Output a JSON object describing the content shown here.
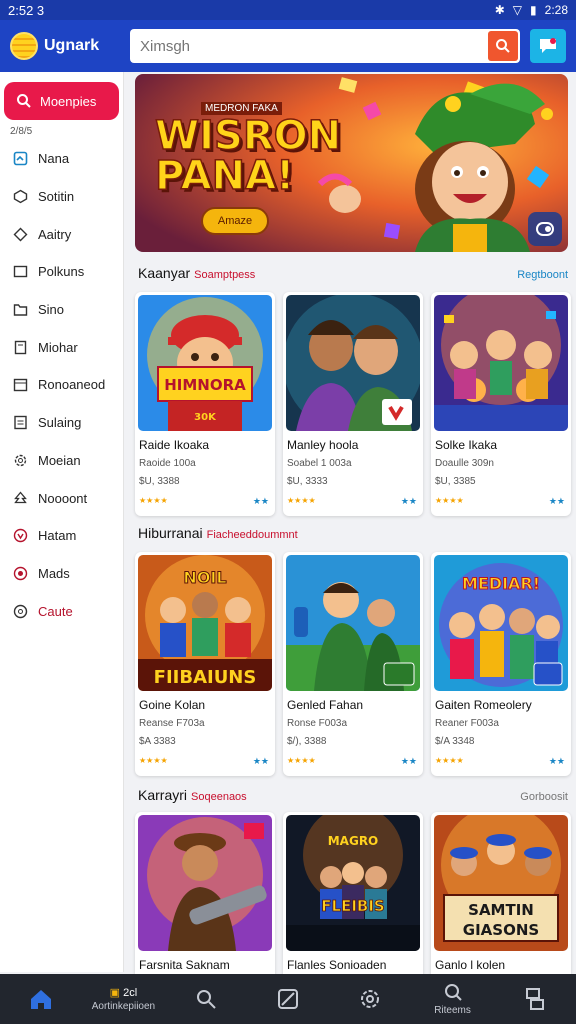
{
  "status": {
    "time": "2:52 3",
    "right_time": "2:28"
  },
  "topbar": {
    "app_name": "Ugnark",
    "search_placeholder": "Ximsgh"
  },
  "sidebar": {
    "active": "Moenpies",
    "small_label": "2/8/5",
    "items": [
      {
        "label": "Nana",
        "icon": "home-icon"
      },
      {
        "label": "Sotitin",
        "icon": "compass-icon"
      },
      {
        "label": "Aaitry",
        "icon": "diamond-icon"
      },
      {
        "label": "Polkuns",
        "icon": "square-icon"
      },
      {
        "label": "Sino",
        "icon": "folder-icon"
      },
      {
        "label": "Miohar",
        "icon": "book-icon"
      },
      {
        "label": "Ronoaneod",
        "icon": "calendar-icon"
      },
      {
        "label": "Sulaing",
        "icon": "document-icon"
      },
      {
        "label": "Moeian",
        "icon": "gear-icon"
      },
      {
        "label": "Noooont",
        "icon": "tree-icon"
      },
      {
        "label": "Hatam",
        "icon": "heart-circle-icon",
        "red": true
      },
      {
        "label": "Mads",
        "icon": "star-circle-icon",
        "red": true
      },
      {
        "label": "Caute",
        "icon": "circle-icon",
        "red": true
      }
    ]
  },
  "banner": {
    "tag": "MEDRON FAKA",
    "title_line1": "WISRON",
    "title_line2": "PANA!",
    "button": "Amaze"
  },
  "sections": [
    {
      "title": "Kaanyar",
      "subtitle": "Soamptpess",
      "more": "Regtboont",
      "cards": [
        {
          "title": "Raide Ikoaka",
          "line2": "Raoide 100a",
          "price": "$U, 3388",
          "badge": "★★"
        },
        {
          "title": "Manley hoola",
          "line2": "Soabel 1 003a",
          "price": "$U, 3333",
          "badge": "★★"
        },
        {
          "title": "Solke Ikaka",
          "line2": "Doaulle 309n",
          "price": "$U, 3385",
          "badge": "★★"
        }
      ]
    },
    {
      "title": "Hiburranai",
      "subtitle": "Fiacheeddoummnt",
      "more": "",
      "cards": [
        {
          "title": "Goine Kolan",
          "line2": "Reanse F703a",
          "price": "$A 3383",
          "badge": "★★"
        },
        {
          "title": "Genled Fahan",
          "line2": "Ronse F003a",
          "price": "$/), 3388",
          "badge": "★★"
        },
        {
          "title": "Gaiten Romeolery",
          "line2": "Reaner F003a",
          "price": "$/A 3348",
          "badge": "★★"
        }
      ]
    },
    {
      "title": "Karrayri",
      "subtitle": "Soqeenaos",
      "more": "Gorboosit",
      "cards": [
        {
          "title": "Farsnita Saknam"
        },
        {
          "title": "Flanles Sonioaden"
        },
        {
          "title": "Ganlo l kolen"
        }
      ]
    }
  ],
  "bottomnav": [
    {
      "icon": "home-icon",
      "label": ""
    },
    {
      "icon": "games-icon",
      "label_top": "2cl",
      "label": "Aortinkepiioen"
    },
    {
      "icon": "search-icon",
      "label": ""
    },
    {
      "icon": "compass-icon",
      "label": ""
    },
    {
      "icon": "gear-icon",
      "label": ""
    },
    {
      "icon": "chat-search-icon",
      "label": "Riteems"
    },
    {
      "icon": "layout-icon",
      "label": ""
    }
  ],
  "colors": {
    "topbar": "#1e44c4",
    "accent_red": "#e8194a",
    "link": "#1a86c5"
  }
}
